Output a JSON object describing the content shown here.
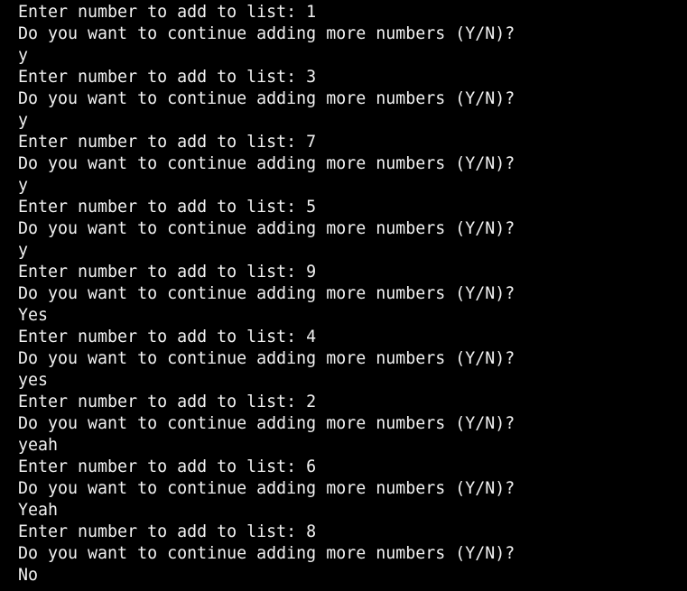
{
  "terminal": {
    "background": "#000000",
    "foreground": "#f2f2f2",
    "lines": [
      "Enter number to add to list: 1",
      "Do you want to continue adding more numbers (Y/N)?",
      "y",
      "Enter number to add to list: 3",
      "Do you want to continue adding more numbers (Y/N)?",
      "y",
      "Enter number to add to list: 7",
      "Do you want to continue adding more numbers (Y/N)?",
      "y",
      "Enter number to add to list: 5",
      "Do you want to continue adding more numbers (Y/N)?",
      "y",
      "Enter number to add to list: 9",
      "Do you want to continue adding more numbers (Y/N)?",
      "Yes",
      "Enter number to add to list: 4",
      "Do you want to continue adding more numbers (Y/N)?",
      "yes",
      "Enter number to add to list: 2",
      "Do you want to continue adding more numbers (Y/N)?",
      "yeah",
      "Enter number to add to list: 6",
      "Do you want to continue adding more numbers (Y/N)?",
      "Yeah",
      "Enter number to add to list: 8",
      "Do you want to continue adding more numbers (Y/N)?",
      "No"
    ]
  }
}
